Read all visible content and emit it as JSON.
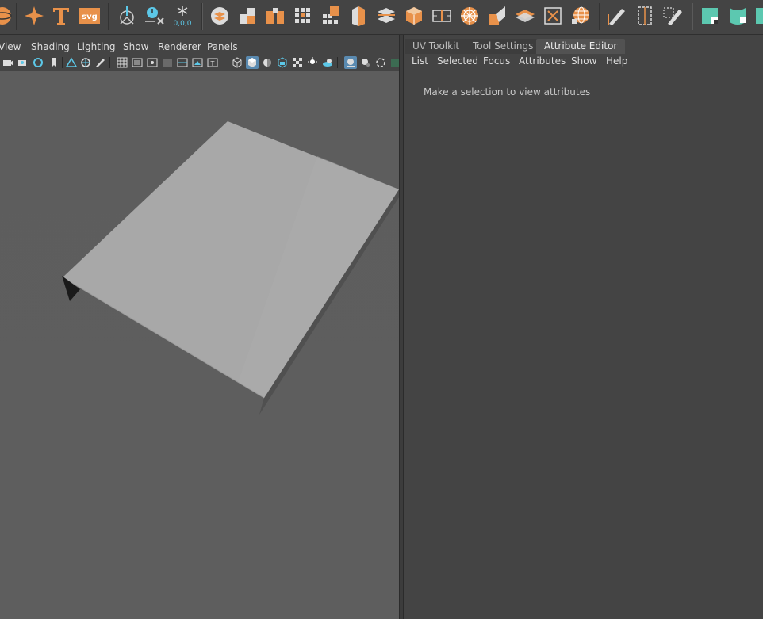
{
  "shelf": {
    "icons": [
      "sphere-icon",
      "sparkle-icon",
      "text-t-icon",
      "svg-icon",
      "pivot-icon",
      "snap-time-icon",
      "freeze-transform-icon",
      "bool-icon",
      "combine-icon",
      "separate-icon",
      "mesh-grid-icon",
      "extrude-icon",
      "bevel-icon",
      "bridge-icon",
      "smooth-icon",
      "cube-icon",
      "insert-loop-icon",
      "target-weld-icon",
      "mirror-icon",
      "quad-draw-icon",
      "bounding-box-icon",
      "sphere-grid-icon",
      "edge-draw-icon",
      "uv-frame-icon",
      "edit-pencil-icon",
      "uv-plane-icon",
      "uv-shell-icon",
      "uv-extra-icon"
    ],
    "svg_label": "svg",
    "coords_label": "0,0,0",
    "accent_color": "#e8914a",
    "teal_color": "#5cc8b0"
  },
  "viewport": {
    "menus": [
      "View",
      "Shading",
      "Lighting",
      "Show",
      "Renderer",
      "Panels"
    ],
    "background_color": "#5e5e5e",
    "plane_color": "#a8a8a8"
  },
  "panel": {
    "tabs": [
      "UV Toolkit",
      "Tool Settings",
      "Attribute Editor"
    ],
    "active_tab": "Attribute Editor",
    "menus": [
      "List",
      "Selected",
      "Focus",
      "Attributes",
      "Show",
      "Help"
    ],
    "message": "Make a selection to view attributes"
  }
}
